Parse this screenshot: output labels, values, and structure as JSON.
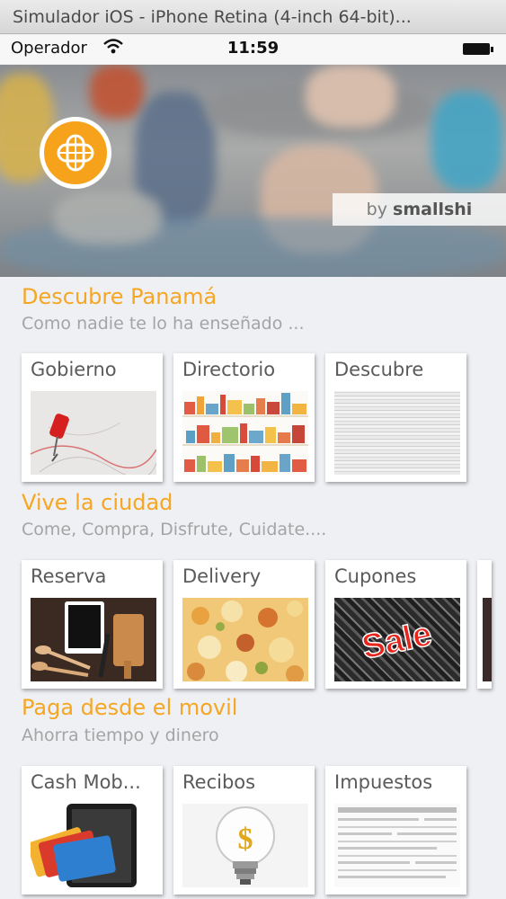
{
  "window": {
    "title": "Simulador iOS - iPhone Retina (4-inch 64-bit)..."
  },
  "status_bar": {
    "carrier": "Operador",
    "time": "11:59"
  },
  "hero": {
    "byline_prefix": "by ",
    "byline_brand": "smallshi"
  },
  "sections": [
    {
      "title": "Descubre Panamá",
      "subtitle": "Como nadie te lo ha enseñado ...",
      "cards": [
        {
          "label": "Gobierno"
        },
        {
          "label": "Directorio"
        },
        {
          "label": "Descubre"
        }
      ]
    },
    {
      "title": "Vive la ciudad",
      "subtitle": "Come, Compra, Disfrute, Cuidate....",
      "cards": [
        {
          "label": "Reserva"
        },
        {
          "label": "Delivery"
        },
        {
          "label": "Cupones"
        }
      ]
    },
    {
      "title": "Paga desde el movil",
      "subtitle": "Ahorra tiempo y dinero",
      "cards": [
        {
          "label": "Cash Mob..."
        },
        {
          "label": "Recibos"
        },
        {
          "label": "Impuestos"
        }
      ]
    }
  ],
  "thumb_text": {
    "sale": "Sale",
    "dollar": "$"
  },
  "colors": {
    "accent": "#f5a623",
    "subtitle": "#a4a4a4",
    "background": "#eff0f4"
  }
}
